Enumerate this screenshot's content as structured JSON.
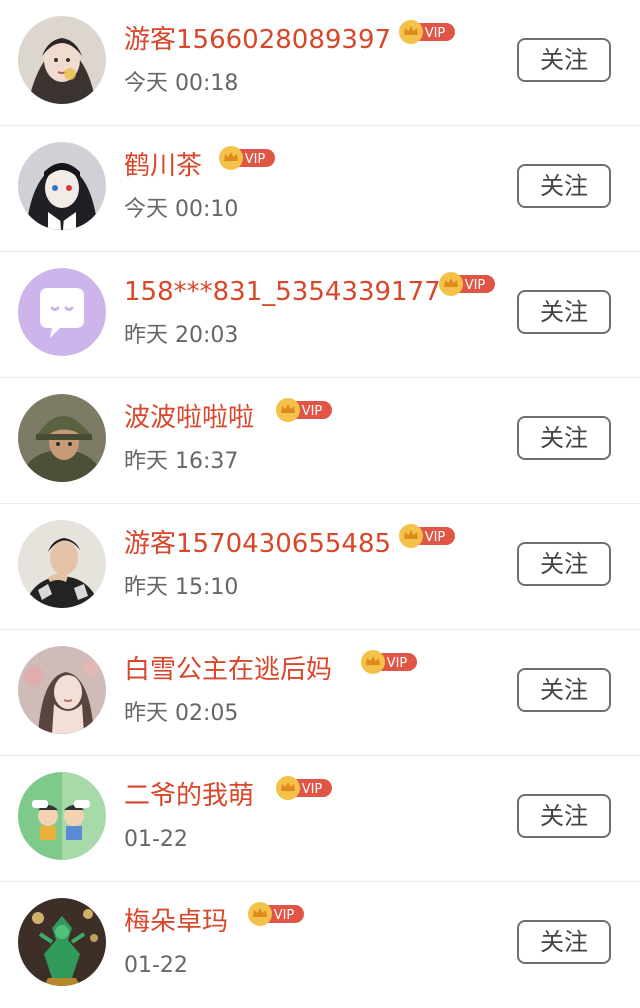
{
  "users": [
    {
      "name": "游客1566028089397",
      "time": "今天 00:18",
      "badge": "VIP",
      "follow_label": "关注"
    },
    {
      "name": "鹤川茶",
      "time": "今天 00:10",
      "badge": "VIP",
      "follow_label": "关注"
    },
    {
      "name": "158***831_5354339177",
      "time": "昨天 20:03",
      "badge": "VIP",
      "follow_label": "关注"
    },
    {
      "name": "波波啦啦啦",
      "time": "昨天 16:37",
      "badge": "VIP",
      "follow_label": "关注"
    },
    {
      "name": "游客1570430655485",
      "time": "昨天 15:10",
      "badge": "VIP",
      "follow_label": "关注"
    },
    {
      "name": "白雪公主在逃后妈",
      "time": "昨天 02:05",
      "badge": "VIP",
      "follow_label": "关注"
    },
    {
      "name": "二爷的我萌",
      "time": "01-22",
      "badge": "VIP",
      "follow_label": "关注"
    },
    {
      "name": "梅朵卓玛",
      "time": "01-22",
      "badge": "VIP",
      "follow_label": "关注"
    }
  ],
  "colors": {
    "name_text": "#d9472b",
    "time_text": "#666666",
    "vip_badge": "#e05545",
    "crown": "#f2b53a"
  }
}
